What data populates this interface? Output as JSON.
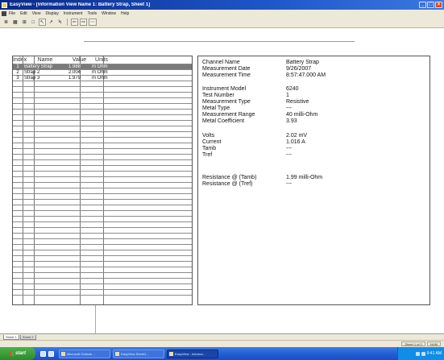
{
  "window": {
    "title": "EasyView - [Information View Name 1: Battery Strap, Sheet 1]",
    "buttons": {
      "minimize": "_",
      "maximize": "□",
      "close": "×"
    }
  },
  "menu": [
    "File",
    "Edit",
    "View",
    "Display",
    "Instrument",
    "Tools",
    "Window",
    "Help"
  ],
  "toolbar": {
    "buttons": [
      "≣",
      "▦",
      "⊞",
      "□",
      "↖",
      "↗",
      "Ϟ",
      "⇦",
      "⇨",
      "⋯"
    ]
  },
  "grid": {
    "headers": {
      "index": "Index",
      "name": "Name",
      "value": "Value",
      "units": "Units"
    },
    "rows": [
      {
        "index": "1",
        "name": "Battery Strap",
        "value": "1.988",
        "units": "m Ohm",
        "selected": true
      },
      {
        "index": "2",
        "name": "Strap 2",
        "value": "2.004",
        "units": "m Ohm",
        "selected": false
      },
      {
        "index": "3",
        "name": "Strap 3",
        "value": "1.979",
        "units": "m Ohm",
        "selected": false
      }
    ]
  },
  "details": {
    "channel_name": {
      "label": "Channel Name",
      "value": "Battery Strap"
    },
    "measurement_date": {
      "label": "Measurement Date",
      "value": "9/26/2007"
    },
    "measurement_time": {
      "label": "Measurement Time",
      "value": "8:57:47.000 AM"
    },
    "instrument_model": {
      "label": "Instrument Model",
      "value": "6240"
    },
    "test_number": {
      "label": "Test Number",
      "value": "1"
    },
    "measurement_type": {
      "label": "Measurement Type",
      "value": "Resistive"
    },
    "metal_type": {
      "label": "Metal Type",
      "value": "---"
    },
    "measurement_range": {
      "label": "Measurement Range",
      "value": "40 milli-Ohm"
    },
    "metal_coefficient": {
      "label": "Metal Coefficient",
      "value": "3.93"
    },
    "volts": {
      "label": "Volts",
      "value": "2.02 mV"
    },
    "current": {
      "label": "Current",
      "value": "1.016 A"
    },
    "tamb": {
      "label": "Tamb",
      "value": "---"
    },
    "tref": {
      "label": "Tref",
      "value": "---"
    },
    "resistance_tamb": {
      "label": "Resistance @ (Tamb)",
      "value": "1.99 milli-Ohm"
    },
    "resistance_tref": {
      "label": "Resistance @ (Tref)",
      "value": "---"
    }
  },
  "sheet_tabs": [
    "Sheet 1",
    "Sheet 2"
  ],
  "statusbar": {
    "cells": [
      "Sheet 1 of 2",
      "NUM"
    ]
  },
  "taskbar": {
    "start_label": "start",
    "tasks": [
      "Microsoft Outlook ...",
      "EasyView Sheet1...",
      "EasyView - Informa..."
    ],
    "clock": "9:41 AM"
  }
}
